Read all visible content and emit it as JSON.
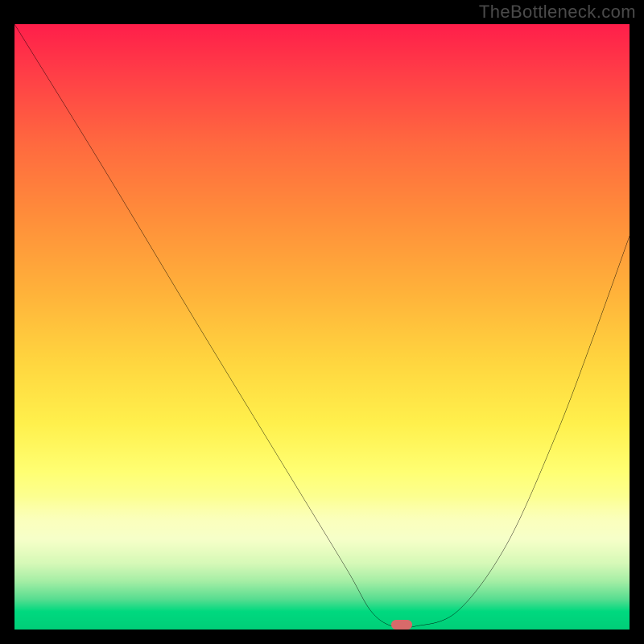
{
  "watermark": "TheBottleneck.com",
  "chart_data": {
    "type": "line",
    "title": "",
    "xlabel": "",
    "ylabel": "",
    "xlim": [
      0,
      100
    ],
    "ylim": [
      0,
      100
    ],
    "grid": false,
    "series": [
      {
        "name": "bottleneck-curve",
        "x": [
          0,
          14,
          30,
          45,
          54,
          58,
          61.5,
          65,
          72,
          80,
          88,
          94,
          100
        ],
        "values": [
          100,
          77,
          50,
          25,
          10,
          3,
          0.5,
          0.5,
          3,
          14,
          32,
          48,
          65
        ],
        "color": "#000000"
      }
    ],
    "optimal_marker": {
      "x": 63,
      "y": 0.8
    },
    "background_gradient": {
      "direction": "vertical",
      "stops": [
        {
          "pos": 0.0,
          "color": "#ff1e4a"
        },
        {
          "pos": 0.32,
          "color": "#ff8e3a"
        },
        {
          "pos": 0.66,
          "color": "#fff04c"
        },
        {
          "pos": 0.8,
          "color": "#fbff9e"
        },
        {
          "pos": 0.92,
          "color": "#a5eea5"
        },
        {
          "pos": 1.0,
          "color": "#00ce78"
        }
      ]
    }
  }
}
